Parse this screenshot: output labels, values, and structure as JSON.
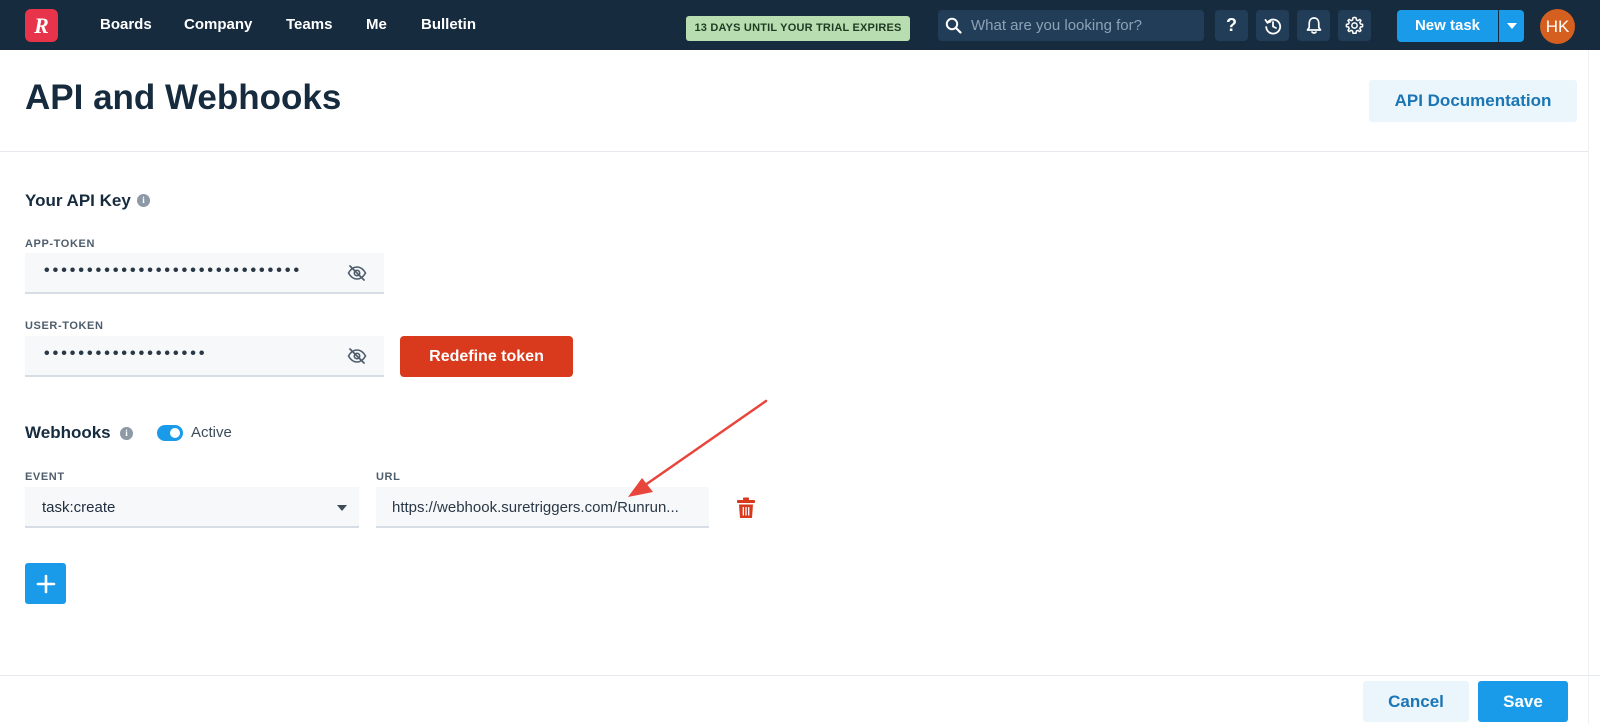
{
  "app": {
    "logo_letter": "R"
  },
  "nav": {
    "items": [
      {
        "label": "Boards"
      },
      {
        "label": "Company"
      },
      {
        "label": "Teams"
      },
      {
        "label": "Me"
      },
      {
        "label": "Bulletin"
      }
    ],
    "trial_badge": "13 DAYS UNTIL YOUR TRIAL EXPIRES",
    "search_placeholder": "What are you looking for?",
    "help_label": "?",
    "new_task_label": "New task",
    "avatar_initials": "HK"
  },
  "page": {
    "title": "API and Webhooks",
    "api_doc_label": "API Documentation"
  },
  "api_key": {
    "section_title": "Your API Key",
    "app_token_label": "APP-TOKEN",
    "app_token_value": "••••••••••••••••••••••••••••••",
    "user_token_label": "USER-TOKEN",
    "user_token_value": "•••••••••••••••••••",
    "redefine_label": "Redefine token"
  },
  "webhooks": {
    "section_title": "Webhooks",
    "active_label": "Active",
    "active": true,
    "event_label": "EVENT",
    "event_value": "task:create",
    "url_label": "URL",
    "url_value": "https://webhook.suretriggers.com/Runrun..."
  },
  "footer": {
    "cancel_label": "Cancel",
    "save_label": "Save"
  },
  "colors": {
    "navbar": "#172b3f",
    "primary": "#1a9bea",
    "danger": "#d93a1d",
    "logo": "#e8344a",
    "trial_badge": "#b7ddb0",
    "annotation_arrow": "#e8453c"
  }
}
